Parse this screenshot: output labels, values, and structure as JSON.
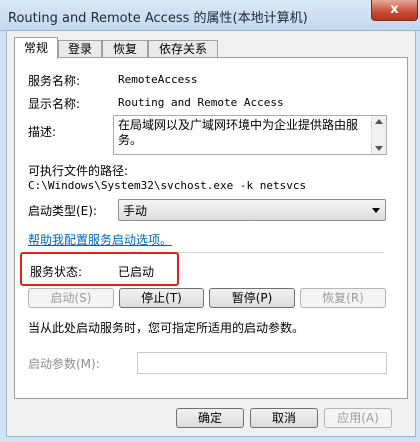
{
  "window": {
    "title": "Routing and Remote Access 的属性(本地计算机)",
    "close_label": "x"
  },
  "tabs": [
    {
      "label": "常规",
      "active": true
    },
    {
      "label": "登录",
      "active": false
    },
    {
      "label": "恢复",
      "active": false
    },
    {
      "label": "依存关系",
      "active": false
    }
  ],
  "general": {
    "service_name_label": "服务名称:",
    "service_name_value": "RemoteAccess",
    "display_name_label": "显示名称:",
    "display_name_value": "Routing and Remote Access",
    "description_label": "描述:",
    "description_value": "在局域网以及广域网环境中为企业提供路由服务。",
    "exe_path_label": "可执行文件的路径:",
    "exe_path_value": "C:\\Windows\\System32\\svchost.exe -k netsvcs",
    "startup_type_label": "启动类型(E):",
    "startup_type_value": "手动",
    "help_link": "帮助我配置服务启动选项。",
    "status_label": "服务状态:",
    "status_value": "已启动",
    "start_button": "启动(S)",
    "stop_button": "停止(T)",
    "pause_button": "暂停(P)",
    "resume_button": "恢复(R)",
    "hint_text": "当从此处启动服务时，您可指定所适用的启动参数。",
    "start_params_label": "启动参数(M):",
    "start_params_value": ""
  },
  "footer": {
    "ok": "确定",
    "cancel": "取消",
    "apply": "应用(A)"
  }
}
